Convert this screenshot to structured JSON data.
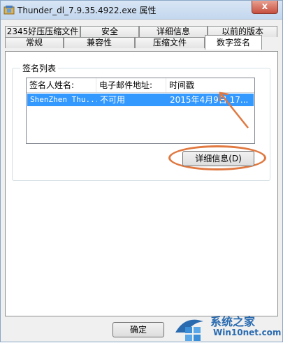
{
  "window": {
    "title": "Thunder_dl_7.9.35.4922.exe 属性",
    "close_label": "x"
  },
  "tabs": {
    "row1": [
      "2345好压压缩文件",
      "安全",
      "详细信息",
      "以前的版本"
    ],
    "row2": [
      "常规",
      "兼容性",
      "压缩文件",
      "数字签名"
    ],
    "active": "数字签名"
  },
  "signature_list": {
    "group_label": "签名列表",
    "columns": [
      "签名人姓名:",
      "电子邮件地址:",
      "时间戳"
    ],
    "rows": [
      {
        "name": "ShenZhen Thu...",
        "email": "不可用",
        "timestamp": "2015年4月9日 17..."
      }
    ],
    "details_button": "详细信息(D)"
  },
  "footer": {
    "ok_button": "确定"
  },
  "watermark": {
    "title": "系统之家",
    "url": "Win10net.com"
  },
  "colors": {
    "selection": "#3399ff",
    "annotation": "#e07840"
  }
}
